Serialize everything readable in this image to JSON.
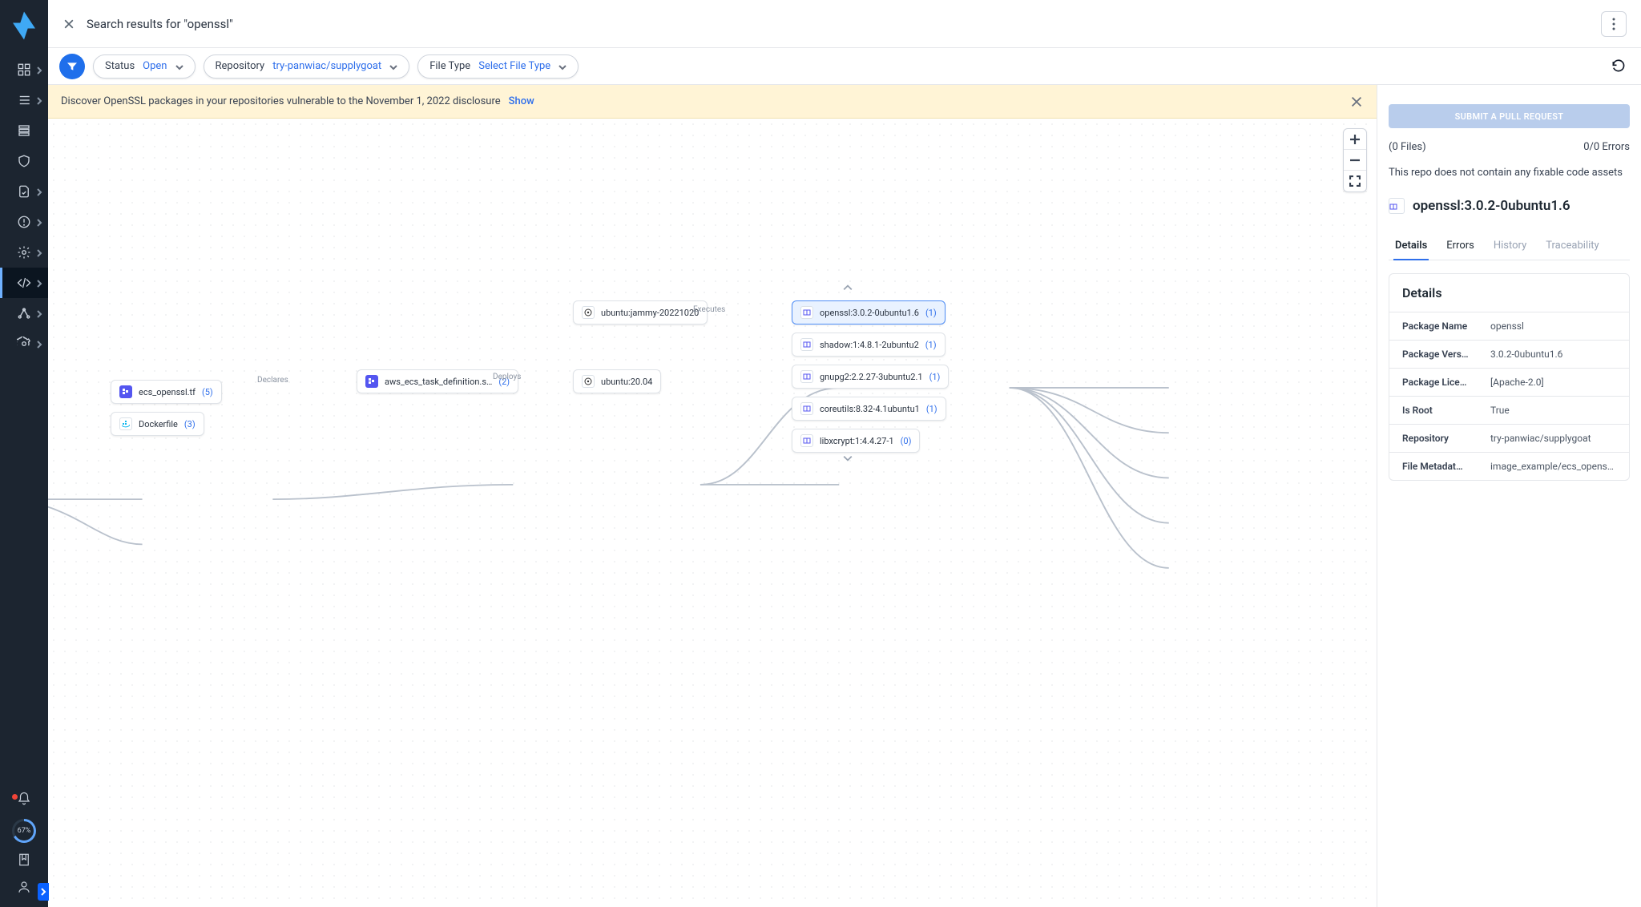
{
  "header": {
    "title": "Search results for \"openssl\""
  },
  "filters": {
    "status": {
      "label": "Status",
      "value": "Open"
    },
    "repository": {
      "label": "Repository",
      "value": "try-panwiac/supplygoat"
    },
    "filetype": {
      "label": "File Type",
      "value": "Select File Type"
    }
  },
  "banner": {
    "text": "Discover OpenSSL packages in your repositories vulnerable to the November 1, 2022 disclosure",
    "action": "Show"
  },
  "graph": {
    "root_files": [
      {
        "id": "ecs",
        "label": "ecs_openssl.tf",
        "count": "(5)",
        "icon": "tf"
      },
      {
        "id": "dockerfile",
        "label": "Dockerfile",
        "count": "(3)",
        "icon": "docker"
      }
    ],
    "task": {
      "label": "aws_ecs_task_definition.s…",
      "count": "(2)",
      "icon": "tf",
      "edge": "Declares"
    },
    "images": [
      {
        "label": "ubuntu:jammy-20221020",
        "icon": "ubuntu",
        "edge_after": "Executes"
      },
      {
        "label": "ubuntu:20.04",
        "icon": "ubuntu"
      }
    ],
    "task_edge": "Deploys",
    "packages": [
      {
        "label": "openssl:3.0.2-0ubuntu1.6",
        "count": "(1)",
        "selected": true
      },
      {
        "label": "shadow:1:4.8.1-2ubuntu2",
        "count": "(1)"
      },
      {
        "label": "gnupg2:2.2.27-3ubuntu2.1",
        "count": "(1)"
      },
      {
        "label": "coreutils:8.32-4.1ubuntu1",
        "count": "(1)"
      },
      {
        "label": "libxcrypt:1:4.4.27-1",
        "count": "(0)"
      }
    ]
  },
  "panel": {
    "pr_button": "SUBMIT A PULL REQUEST",
    "files_summary": "(0 Files)",
    "errors_summary": "0/0 Errors",
    "no_fix_note": "This repo does not contain any fixable code assets",
    "selected_title": "openssl:3.0.2-0ubuntu1.6",
    "tabs": [
      "Details",
      "Errors",
      "History",
      "Traceability"
    ],
    "details_heading": "Details",
    "details": [
      {
        "k": "Package Name",
        "v": "openssl"
      },
      {
        "k": "Package Vers…",
        "v": "3.0.2-0ubuntu1.6"
      },
      {
        "k": "Package Lice…",
        "v": "[Apache-2.0]"
      },
      {
        "k": "Is Root",
        "v": "True"
      },
      {
        "k": "Repository",
        "v": "try-panwiac/supplygoat"
      },
      {
        "k": "File Metadat…",
        "v": "image_example/ecs_openssl.tf"
      }
    ]
  },
  "rail": {
    "progress": "67%"
  }
}
